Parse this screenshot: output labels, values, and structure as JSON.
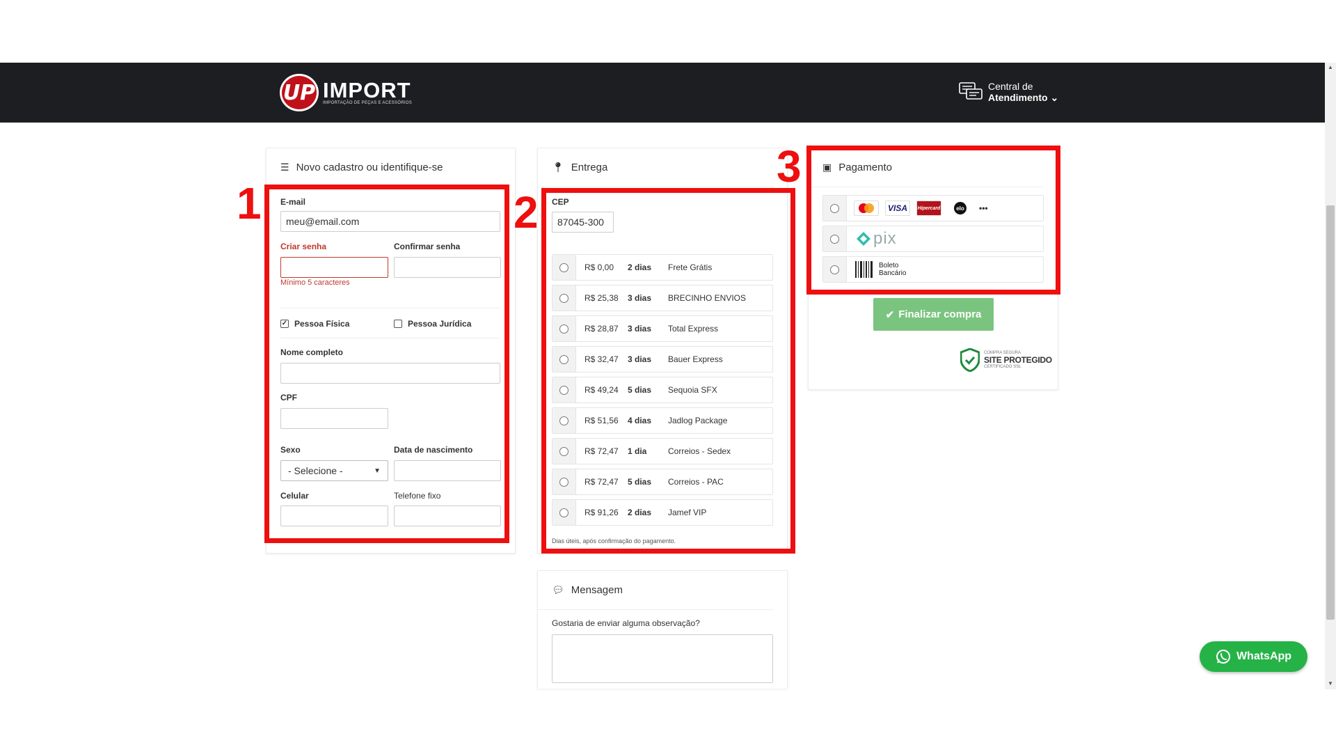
{
  "header": {
    "logo_name": "IMPORT",
    "logo_mark": "UP",
    "logo_subtitle": "IMPORTAÇÃO DE PEÇAS E ACESSÓRIOS",
    "support_line1": "Central de",
    "support_line2": "Atendimento ⌄"
  },
  "annotations": {
    "n1": "1",
    "n2": "2",
    "n3": "3"
  },
  "cadastro": {
    "title": "Novo cadastro ou identifique-se",
    "email_label": "E-mail",
    "email_value": "meu@email.com",
    "senha_label": "Criar senha",
    "confirmar_label": "Confirmar senha",
    "senha_hint": "Mínimo 5 caracteres",
    "pf_label": "Pessoa Física",
    "pj_label": "Pessoa Jurídica",
    "nome_label": "Nome completo",
    "cpf_label": "CPF",
    "sexo_label": "Sexo",
    "sexo_value": "- Selecione -",
    "nasc_label": "Data de nascimento",
    "celular_label": "Celular",
    "fixo_label": "Telefone fixo"
  },
  "entrega": {
    "title": "Entrega",
    "cep_label": "CEP",
    "cep_value": "87045-300",
    "options": [
      {
        "price": "R$ 0,00",
        "days": "2 dias",
        "name": "Frete Grátis"
      },
      {
        "price": "R$ 25,38",
        "days": "3 dias",
        "name": "BRECINHO ENVIOS"
      },
      {
        "price": "R$ 28,87",
        "days": "3 dias",
        "name": "Total Express"
      },
      {
        "price": "R$ 32,47",
        "days": "3 dias",
        "name": "Bauer Express"
      },
      {
        "price": "R$ 49,24",
        "days": "5 dias",
        "name": "Sequoia SFX"
      },
      {
        "price": "R$ 51,56",
        "days": "4 dias",
        "name": "Jadlog Package"
      },
      {
        "price": "R$ 72,47",
        "days": "1 dia",
        "name": "Correios - Sedex"
      },
      {
        "price": "R$ 72,47",
        "days": "5 dias",
        "name": "Correios - PAC"
      },
      {
        "price": "R$ 91,26",
        "days": "2 dias",
        "name": "Jamef VIP"
      }
    ],
    "note": "Dias úteis, após confirmação do pagamento."
  },
  "mensagem": {
    "title": "Mensagem",
    "label": "Gostaria de enviar alguma observação?"
  },
  "pagamento": {
    "title": "Pagamento",
    "cards": [
      "mastercard",
      "VISA",
      "Hipercard",
      "elo"
    ],
    "more": "•••",
    "pix_label": "pix",
    "boleto_line1": "Boleto",
    "boleto_line2": "Bancário",
    "finalizar": "Finalizar compra",
    "ssl_top": "COMPRA SEGURA",
    "ssl_main": "SITE PROTEGIDO",
    "ssl_bottom": "CERTIFICADO SSL"
  },
  "whatsapp": {
    "label": "WhatsApp"
  },
  "colors": {
    "header_bg": "#1c1e21",
    "accent_red": "#ee0f0f",
    "button_green": "#7ac47f",
    "whatsapp_green": "#25b347",
    "error": "#c0392b"
  }
}
